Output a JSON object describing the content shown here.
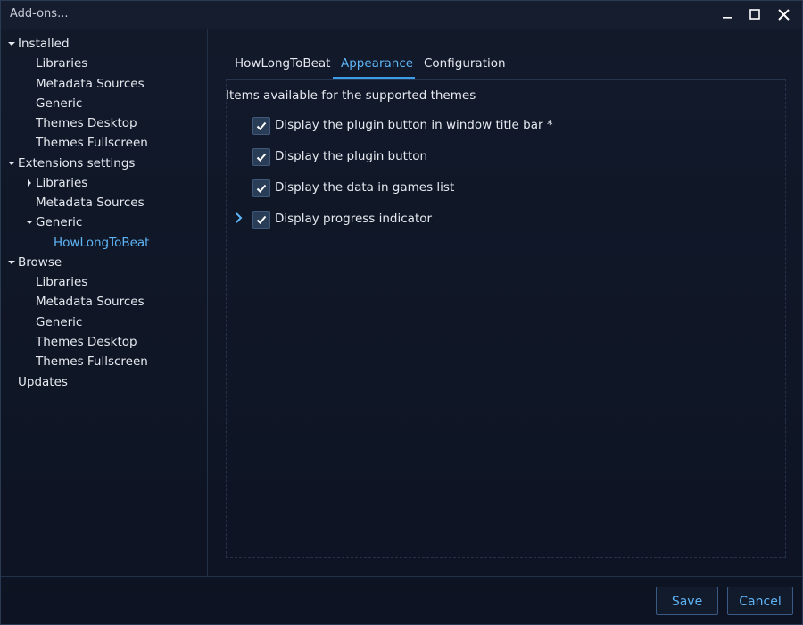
{
  "window": {
    "title": "Add-ons..."
  },
  "sidebar": {
    "items": [
      {
        "label": "Installed",
        "expander": "expanded"
      },
      {
        "label": "Libraries"
      },
      {
        "label": "Metadata Sources"
      },
      {
        "label": "Generic"
      },
      {
        "label": "Themes Desktop"
      },
      {
        "label": "Themes Fullscreen"
      },
      {
        "label": "Extensions settings",
        "expander": "expanded"
      },
      {
        "label": "Libraries",
        "expander": "collapsed"
      },
      {
        "label": "Metadata Sources"
      },
      {
        "label": "Generic",
        "expander": "expanded"
      },
      {
        "label": "HowLongToBeat",
        "selected": true
      },
      {
        "label": "Browse",
        "expander": "expanded"
      },
      {
        "label": "Libraries"
      },
      {
        "label": "Metadata Sources"
      },
      {
        "label": "Generic"
      },
      {
        "label": "Themes Desktop"
      },
      {
        "label": "Themes Fullscreen"
      },
      {
        "label": "Updates"
      }
    ]
  },
  "tabs": [
    {
      "label": "HowLongToBeat"
    },
    {
      "label": "Appearance",
      "active": true
    },
    {
      "label": "Configuration"
    }
  ],
  "section": {
    "title": "Items available for the supported themes"
  },
  "options": [
    {
      "label": "Display the plugin button in window title bar *",
      "checked": true
    },
    {
      "label": "Display the plugin button",
      "checked": true
    },
    {
      "label": "Display the data in games list",
      "checked": true
    },
    {
      "label": "Display progress indicator",
      "checked": true,
      "expandable": true
    }
  ],
  "buttons": {
    "save": "Save",
    "cancel": "Cancel"
  },
  "colors": {
    "accent": "#5fb4f5",
    "background": "#0f1524",
    "checkbox": "#2a3d57"
  },
  "icons": {
    "minimize": "minimize-icon",
    "maximize": "maximize-icon",
    "close": "close-icon",
    "tree_expanded": "caret-down-icon",
    "tree_collapsed": "caret-right-icon",
    "check": "checkmark-icon",
    "expand": "chevron-right-icon"
  }
}
